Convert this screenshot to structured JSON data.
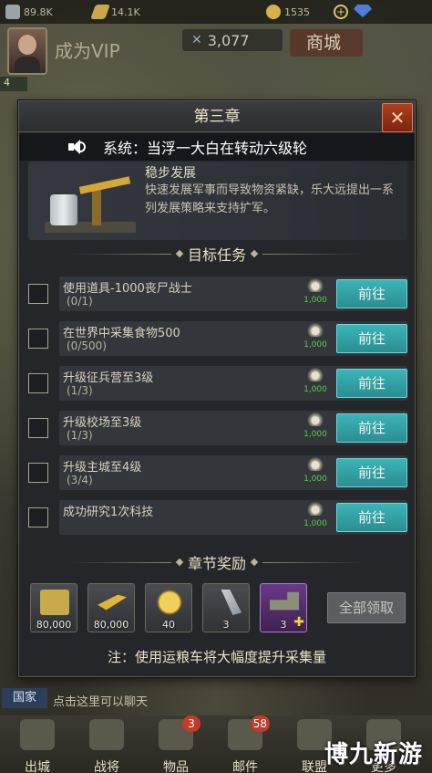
{
  "topbar": {
    "iron": "89.8K",
    "bullets": "14.1K",
    "gold": "1535"
  },
  "hud": {
    "vip": "成为VIP",
    "power": "3,077",
    "shop": "商城",
    "level": "4"
  },
  "modal": {
    "title": "第三章",
    "notice": "系统：当浮一大白在转动六级轮",
    "info_title": "稳步发展",
    "info_desc": "快速发展军事而导致物资紧缺，乐大远提出一系列发展策略来支持扩军。",
    "tasks_title": "目标任务",
    "tasks": [
      {
        "name": "使用道具-1000丧尸战士",
        "progress": "(0/1)",
        "reward": "1,000",
        "button": "前往"
      },
      {
        "name": "在世界中采集食物500",
        "progress": "(0/500)",
        "reward": "1,000",
        "button": "前往"
      },
      {
        "name": "升级征兵营至3级",
        "progress": "(1/3)",
        "reward": "1,000",
        "button": "前往"
      },
      {
        "name": "升级校场至3级",
        "progress": "(1/3)",
        "reward": "1,000",
        "button": "前往"
      },
      {
        "name": "升级主城至4级",
        "progress": "(3/4)",
        "reward": "1,000",
        "button": "前往"
      },
      {
        "name": "成功研究1次科技",
        "progress": "",
        "reward": "1,000",
        "button": "前往"
      }
    ],
    "rewards_title": "章节奖励",
    "rewards": [
      {
        "icon": "supply-box-icon",
        "qty": "80,000"
      },
      {
        "icon": "bullet-icon",
        "qty": "80,000"
      },
      {
        "icon": "gold-coin-icon",
        "qty": "40"
      },
      {
        "icon": "shell-icon",
        "qty": "3"
      },
      {
        "icon": "grain-truck-icon",
        "qty": "3"
      }
    ],
    "claim_all": "全部领取",
    "footer_note": "注：使用运粮车将大幅度提升采集量"
  },
  "bottom": {
    "country_tab": "国家",
    "chat_hint": "点击这里可以聊天",
    "nav": [
      {
        "label": "出城",
        "badge": ""
      },
      {
        "label": "战将",
        "badge": ""
      },
      {
        "label": "物品",
        "badge": "3"
      },
      {
        "label": "邮件",
        "badge": "58"
      },
      {
        "label": "联盟",
        "badge": ""
      },
      {
        "label": "更多",
        "badge": ""
      }
    ],
    "watermark": "博九新游"
  }
}
